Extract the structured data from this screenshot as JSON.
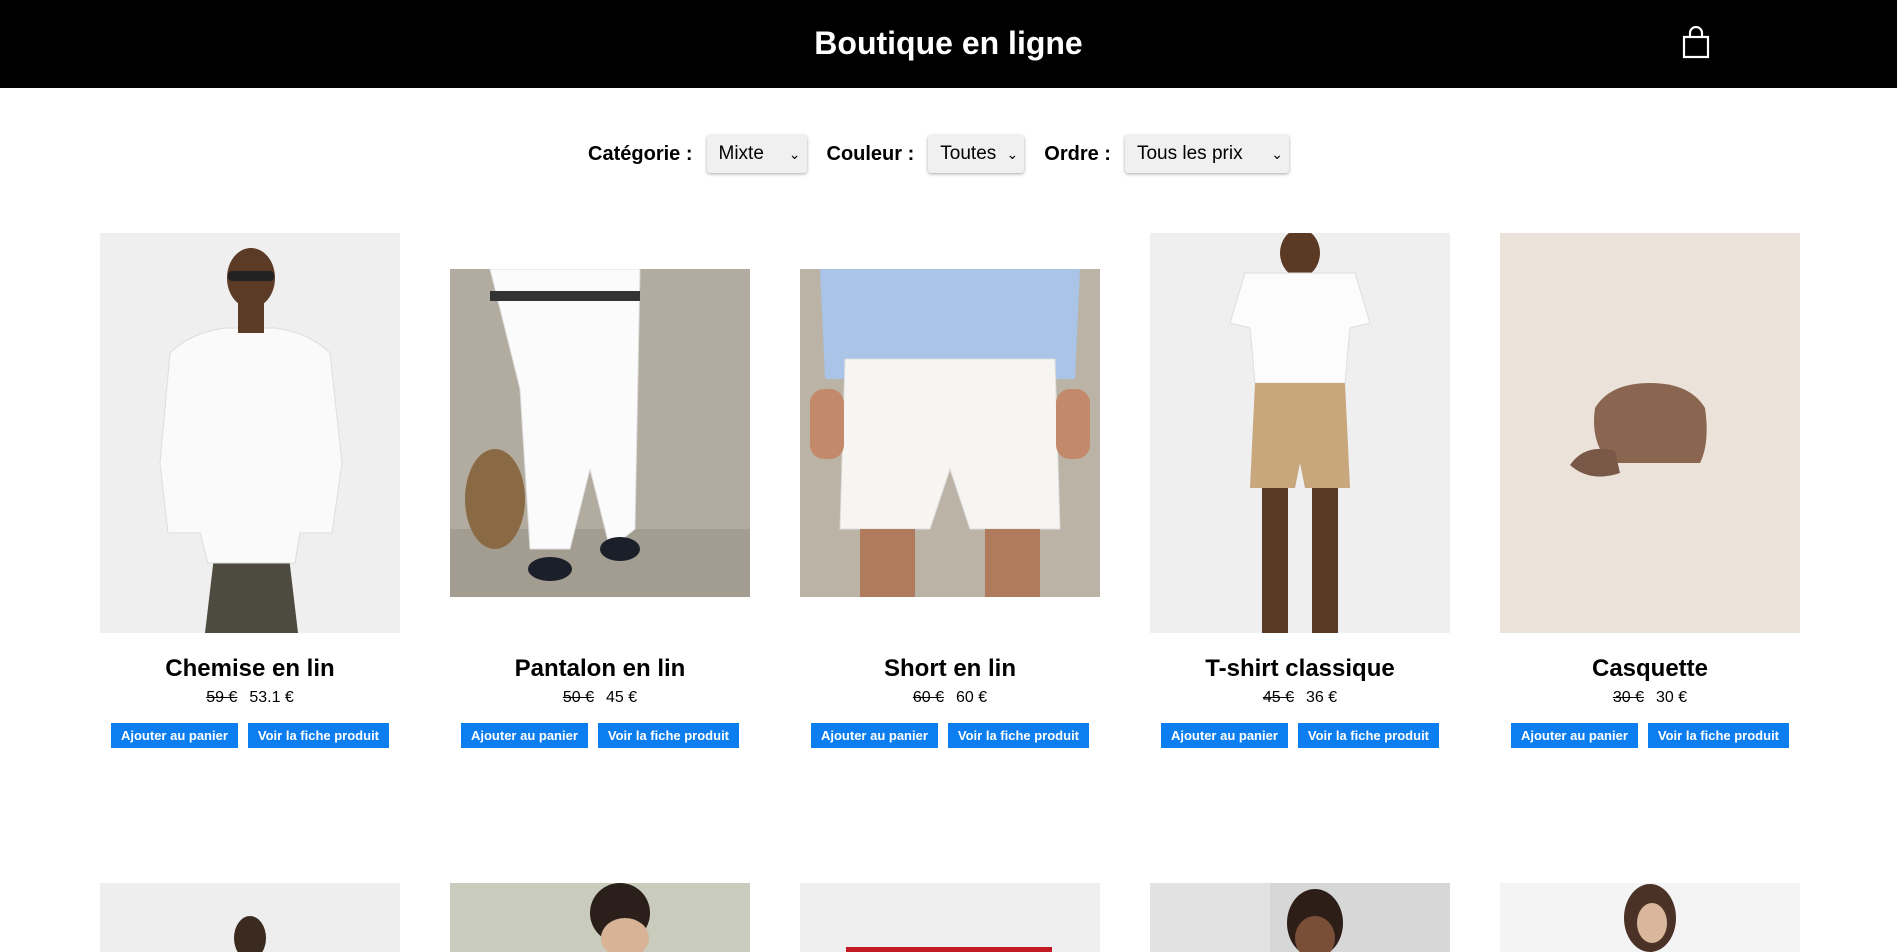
{
  "header": {
    "title": "Boutique en ligne",
    "cart_icon": "shopping-bag-icon"
  },
  "filters": {
    "category_label": "Catégorie :",
    "category_value": "Mixte",
    "color_label": "Couleur :",
    "color_value": "Toutes",
    "order_label": "Ordre :",
    "order_value": "Tous les prix"
  },
  "buttons": {
    "add_to_cart": "Ajouter au panier",
    "view_product": "Voir la fiche produit"
  },
  "products": [
    {
      "name": "Chemise en lin",
      "old_price": "59 €",
      "price": "53.1 €"
    },
    {
      "name": "Pantalon en lin",
      "old_price": "50 €",
      "price": "45 €"
    },
    {
      "name": "Short en lin",
      "old_price": "60 €",
      "price": "60 €"
    },
    {
      "name": "T-shirt classique",
      "old_price": "45 €",
      "price": "36 €"
    },
    {
      "name": "Casquette",
      "old_price": "30 €",
      "price": "30 €"
    }
  ]
}
